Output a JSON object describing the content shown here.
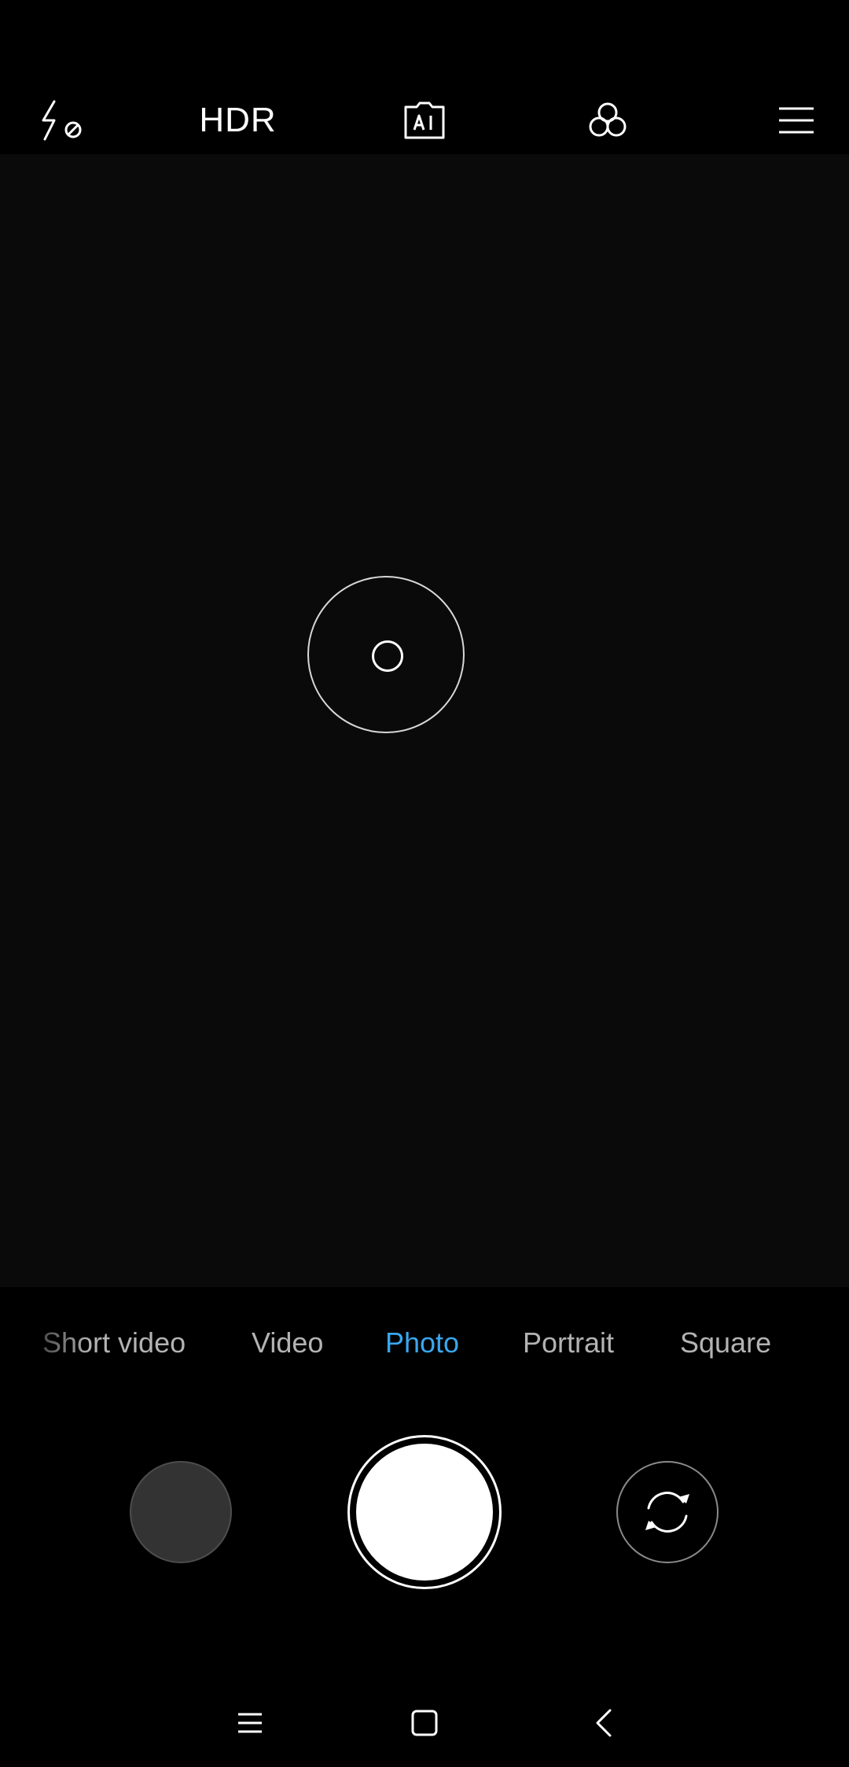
{
  "top_bar": {
    "hdr_label": "HDR",
    "icons": [
      "flash-off-icon",
      "ai-camera-icon",
      "filters-icon",
      "menu-icon"
    ]
  },
  "modes": [
    {
      "label": "Short video",
      "active": false
    },
    {
      "label": "Video",
      "active": false
    },
    {
      "label": "Photo",
      "active": true
    },
    {
      "label": "Portrait",
      "active": false
    },
    {
      "label": "Square",
      "active": false
    }
  ],
  "colors": {
    "active_mode": "#3aa6ee",
    "inactive_mode": "#b3b3b3",
    "viewfinder": "#0a0a0a"
  },
  "nav_bar": {
    "icons": [
      "recents-icon",
      "home-icon",
      "back-icon"
    ]
  }
}
